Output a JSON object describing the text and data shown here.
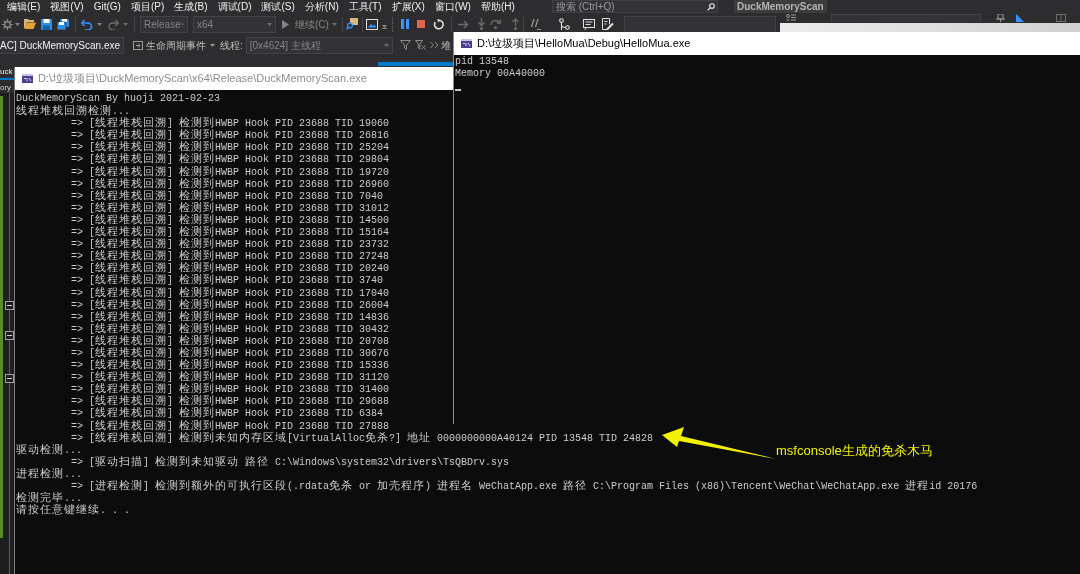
{
  "ide": {
    "menu": [
      "编辑(E)",
      "视图(V)",
      "Git(G)",
      "项目(P)",
      "生成(B)",
      "调试(D)",
      "测试(S)",
      "分析(N)",
      "工具(T)",
      "扩展(X)",
      "窗口(W)",
      "帮助(H)"
    ],
    "search": {
      "placeholder": "搜索 (Ctrl+Q)"
    },
    "solution_name": "DuckMemoryScan",
    "toolbar": {
      "configuration": {
        "value": "Release",
        "disabled": true
      },
      "platform": {
        "value": "x64",
        "disabled": true
      },
      "continue": {
        "label": "继续(C)",
        "disabled": true
      }
    },
    "debug_location": {
      "process": {
        "value": "AC] DuckMemoryScan.exe",
        "disabled": false
      },
      "lifecycle_events": "生命周期事件",
      "thread_label": "线程:",
      "thread": {
        "value": "[0x4624] 主线程",
        "disabled": true
      },
      "stack_frame_label": "堆"
    },
    "document_tab": {
      "label": "uck",
      "selected": true
    },
    "navigation_bar": "ory"
  },
  "console_windows": [
    {
      "title": "D:\\垃圾项目\\DuckMemoryScan\\x64\\Release\\DuckMemoryScan.exe",
      "active": false,
      "cursor": false,
      "lines": [
        {
          "kind": "plain",
          "text": "DuckMemoryScan By huoji 2021-02-23"
        },
        {
          "kind": "plain",
          "text": "线程堆栈回溯检测..."
        },
        {
          "kind": "indented",
          "text": "=> [线程堆栈回溯] 检测到HWBP Hook PID 23688 TID 19060"
        },
        {
          "kind": "indented",
          "text": "=> [线程堆栈回溯] 检测到HWBP Hook PID 23688 TID 26816"
        },
        {
          "kind": "indented",
          "text": "=> [线程堆栈回溯] 检测到HWBP Hook PID 23688 TID 25204"
        },
        {
          "kind": "indented",
          "text": "=> [线程堆栈回溯] 检测到HWBP Hook PID 23688 TID 29804"
        },
        {
          "kind": "indented",
          "text": "=> [线程堆栈回溯] 检测到HWBP Hook PID 23688 TID 19720"
        },
        {
          "kind": "indented",
          "text": "=> [线程堆栈回溯] 检测到HWBP Hook PID 23688 TID 26960"
        },
        {
          "kind": "indented",
          "text": "=> [线程堆栈回溯] 检测到HWBP Hook PID 23688 TID 7040"
        },
        {
          "kind": "indented",
          "text": "=> [线程堆栈回溯] 检测到HWBP Hook PID 23688 TID 31012"
        },
        {
          "kind": "indented",
          "text": "=> [线程堆栈回溯] 检测到HWBP Hook PID 23688 TID 14500"
        },
        {
          "kind": "indented",
          "text": "=> [线程堆栈回溯] 检测到HWBP Hook PID 23688 TID 15164"
        },
        {
          "kind": "indented",
          "text": "=> [线程堆栈回溯] 检测到HWBP Hook PID 23688 TID 23732"
        },
        {
          "kind": "indented",
          "text": "=> [线程堆栈回溯] 检测到HWBP Hook PID 23688 TID 27248"
        },
        {
          "kind": "indented",
          "text": "=> [线程堆栈回溯] 检测到HWBP Hook PID 23688 TID 20240"
        },
        {
          "kind": "indented",
          "text": "=> [线程堆栈回溯] 检测到HWBP Hook PID 23688 TID 3740"
        },
        {
          "kind": "indented",
          "text": "=> [线程堆栈回溯] 检测到HWBP Hook PID 23688 TID 17040"
        },
        {
          "kind": "indented",
          "text": "=> [线程堆栈回溯] 检测到HWBP Hook PID 23688 TID 26004"
        },
        {
          "kind": "indented",
          "text": "=> [线程堆栈回溯] 检测到HWBP Hook PID 23688 TID 14836"
        },
        {
          "kind": "indented",
          "text": "=> [线程堆栈回溯] 检测到HWBP Hook PID 23688 TID 30432"
        },
        {
          "kind": "indented",
          "text": "=> [线程堆栈回溯] 检测到HWBP Hook PID 23688 TID 20708"
        },
        {
          "kind": "indented",
          "text": "=> [线程堆栈回溯] 检测到HWBP Hook PID 23688 TID 30676"
        },
        {
          "kind": "indented",
          "text": "=> [线程堆栈回溯] 检测到HWBP Hook PID 23688 TID 15336"
        },
        {
          "kind": "indented",
          "text": "=> [线程堆栈回溯] 检测到HWBP Hook PID 23688 TID 31120"
        },
        {
          "kind": "indented",
          "text": "=> [线程堆栈回溯] 检测到HWBP Hook PID 23688 TID 31400"
        },
        {
          "kind": "indented",
          "text": "=> [线程堆栈回溯] 检测到HWBP Hook PID 23688 TID 29688"
        },
        {
          "kind": "indented",
          "text": "=> [线程堆栈回溯] 检测到HWBP Hook PID 23688 TID 6384"
        },
        {
          "kind": "indented",
          "text": "=> [线程堆栈回溯] 检测到HWBP Hook PID 23688 TID 27888"
        },
        {
          "kind": "indented",
          "text": "=> [线程堆栈回溯] 检测到未知内存区域[VirtualAlloc免杀?] 地址 0000000000A40124 PID 13548 TID 24828"
        },
        {
          "kind": "plain",
          "text": "驱动检测..."
        },
        {
          "kind": "indented",
          "text": "=> [驱动扫描] 检测到未知驱动 路径 C:\\Windows\\system32\\drivers\\TsQBDrv.sys"
        },
        {
          "kind": "plain",
          "text": "进程检测..."
        },
        {
          "kind": "indented",
          "text": "=> [进程检测] 检测到额外的可执行区段(.rdata免杀 or 加壳程序) 进程名 WeChatApp.exe 路径 C:\\Program Files (x86)\\Tencent\\WeChat\\WeChatApp.exe 进程id 20176"
        },
        {
          "kind": "plain",
          "text": "检测完毕..."
        },
        {
          "kind": "plain",
          "text": "请按任意键继续. . ."
        }
      ]
    },
    {
      "title": "D:\\垃圾项目\\HelloMua\\Debug\\HelloMua.exe",
      "active": true,
      "cursor": true,
      "lines": [
        {
          "kind": "plain",
          "text": "pid 13548"
        },
        {
          "kind": "plain",
          "text": "Memory 00A40000"
        }
      ]
    }
  ],
  "annotation": {
    "text": "msfconsole生成的免杀木马"
  }
}
